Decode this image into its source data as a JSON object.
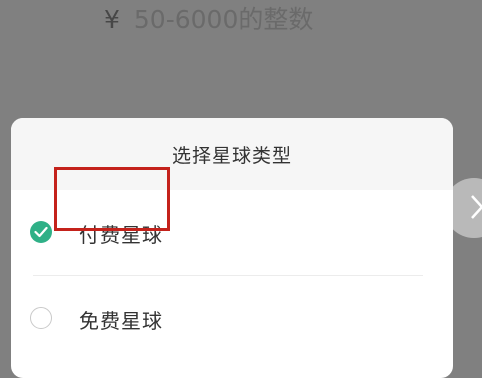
{
  "background": {
    "currency_symbol": "¥",
    "amount_placeholder": "50-6000的整数"
  },
  "dialog": {
    "title": "选择星球类型",
    "options": [
      {
        "label": "付费星球",
        "selected": true
      },
      {
        "label": "免费星球",
        "selected": false
      }
    ],
    "accent_color": "#2fb087",
    "highlight_color": "#c4221b"
  }
}
